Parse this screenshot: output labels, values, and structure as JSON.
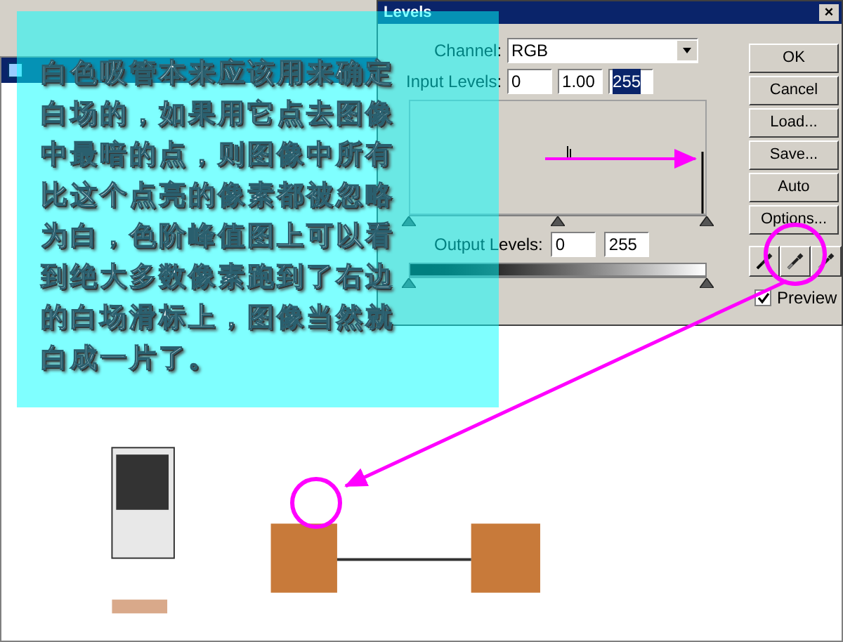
{
  "overlay_text": "白色吸管本来应该用来确定白场的，如果用它点去图像中最暗的点，则图像中所有比这个点亮的像素都被忽略为白，色阶峰值图上可以看到绝大多数像素跑到了右边的白场滑标上，图像当然就白成一片了。",
  "dialog": {
    "title": "Levels",
    "close": "×",
    "channel": {
      "label": "Channel:",
      "value": "RGB"
    },
    "input_levels": {
      "label": "Input Levels:",
      "fields": [
        {
          "value": "0",
          "selected": false
        },
        {
          "value": "1.00",
          "selected": false
        },
        {
          "value": "255",
          "selected": true
        }
      ]
    },
    "input_sliders": [
      {
        "level": 0
      },
      {
        "level": 0.5
      },
      {
        "level": 1
      }
    ],
    "output_levels": {
      "label": "Output Levels:",
      "fields": [
        "0",
        "255"
      ]
    },
    "output_sliders": [
      {
        "level": 0
      },
      {
        "level": 1
      }
    ],
    "buttons": [
      "OK",
      "Cancel",
      "Load...",
      "Save...",
      "Auto",
      "Options..."
    ],
    "preview": {
      "label": "Preview",
      "checked": true
    }
  }
}
